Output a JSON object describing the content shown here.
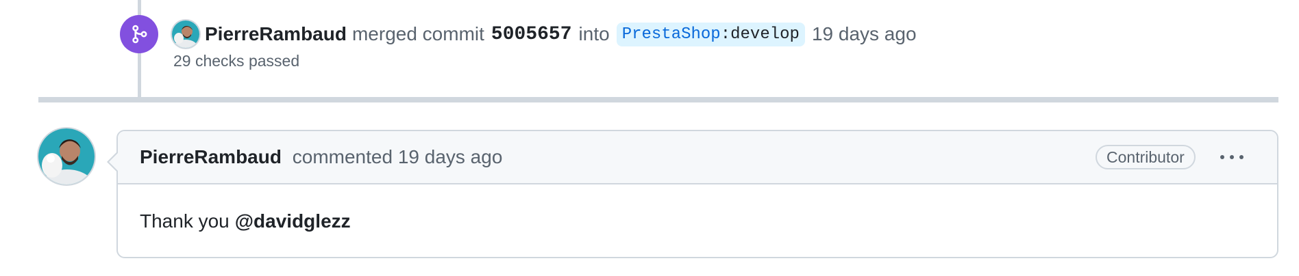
{
  "merge_event": {
    "icon": "git-merge-icon",
    "author": "PierreRambaud",
    "action": "merged commit",
    "commit_sha": "5005657",
    "into_text": "into",
    "branch_repo": "PrestaShop",
    "branch_sep": ":",
    "branch_name": "develop",
    "time": "19 days ago",
    "checks_text": "29 checks passed",
    "colors": {
      "badge": "#8250df",
      "branch_bg": "#ddf4ff",
      "branch_repo": "#0969da"
    }
  },
  "comment": {
    "author": "PierreRambaud",
    "action": "commented",
    "time": "19 days ago",
    "role_badge": "Contributor",
    "menu_icon": "kebab-horizontal-icon",
    "body_text": "Thank you",
    "mention": "@davidglezz"
  }
}
